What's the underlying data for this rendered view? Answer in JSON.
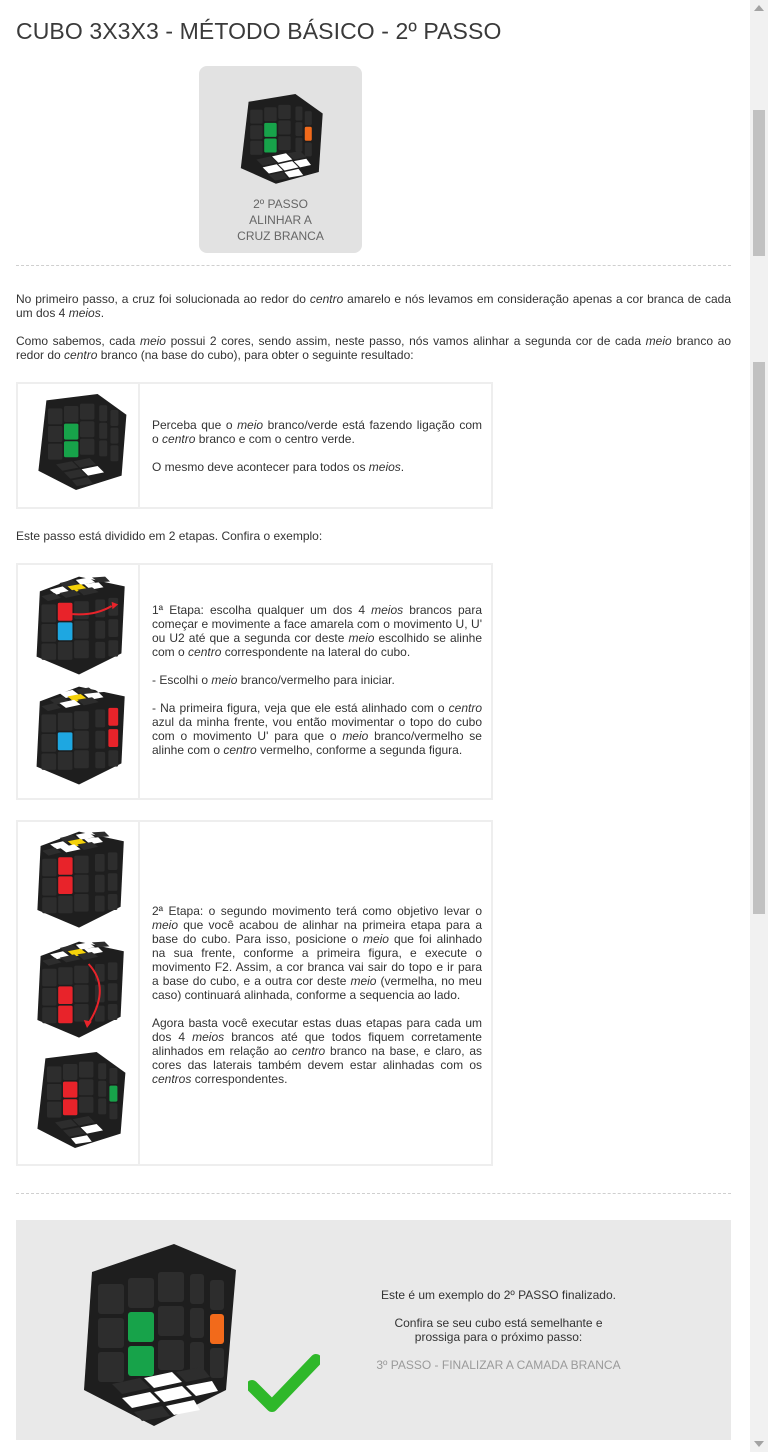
{
  "page": {
    "title": "CUBO 3X3X3 - MÉTODO BÁSICO - 2º PASSO"
  },
  "step_card": {
    "line1": "2º PASSO",
    "line2": "ALINHAR A",
    "line3": "CRUZ BRANCA"
  },
  "intro": {
    "p1": [
      {
        "t": "No primeiro passo, a cruz foi solucionada ao redor do "
      },
      {
        "t": "centro",
        "i": true
      },
      {
        "t": " amarelo e nós levamos em consideração apenas a cor branca de cada um dos 4 "
      },
      {
        "t": "meios",
        "i": true
      },
      {
        "t": "."
      }
    ],
    "p2": [
      {
        "t": "Como sabemos, cada "
      },
      {
        "t": "meio",
        "i": true
      },
      {
        "t": " possui 2 cores, sendo assim, neste passo, nós vamos alinhar a segunda cor de cada "
      },
      {
        "t": "meio",
        "i": true
      },
      {
        "t": " branco ao redor do "
      },
      {
        "t": "centro",
        "i": true
      },
      {
        "t": " branco (na base do cubo), para obter o seguinte resultado:"
      }
    ]
  },
  "box1": {
    "p1": [
      {
        "t": "Perceba que o "
      },
      {
        "t": "meio",
        "i": true
      },
      {
        "t": " branco/verde está fazendo ligação com o "
      },
      {
        "t": "centro",
        "i": true
      },
      {
        "t": " branco e com o centro verde."
      }
    ],
    "p2": [
      {
        "t": "O mesmo deve acontecer para todos os "
      },
      {
        "t": "meios",
        "i": true
      },
      {
        "t": "."
      }
    ]
  },
  "divided_text": "Este passo está dividido em 2 etapas. Confira o exemplo:",
  "box2": {
    "p1": [
      {
        "t": "1ª Etapa: escolha qualquer um dos 4 "
      },
      {
        "t": "meios",
        "i": true
      },
      {
        "t": " brancos para começar e movimente a face amarela com o movimento U, U' ou U2 até que a segunda cor deste "
      },
      {
        "t": "meio",
        "i": true
      },
      {
        "t": " escolhido se alinhe com o "
      },
      {
        "t": "centro",
        "i": true
      },
      {
        "t": " correspondente na lateral do cubo."
      }
    ],
    "p2": [
      {
        "t": "- Escolhi o "
      },
      {
        "t": "meio",
        "i": true
      },
      {
        "t": " branco/vermelho para iniciar."
      }
    ],
    "p3": [
      {
        "t": "- Na primeira figura, veja que ele está alinhado com o "
      },
      {
        "t": "centro",
        "i": true
      },
      {
        "t": " azul da minha frente, vou então movimentar o topo do cubo com o movimento U' para que o "
      },
      {
        "t": "meio",
        "i": true
      },
      {
        "t": " branco/vermelho se alinhe com o "
      },
      {
        "t": "centro",
        "i": true
      },
      {
        "t": " vermelho, conforme a segunda figura."
      }
    ]
  },
  "box3": {
    "p1": [
      {
        "t": "2ª Etapa: o segundo movimento terá como objetivo levar o "
      },
      {
        "t": "meio",
        "i": true
      },
      {
        "t": " que você acabou de alinhar na primeira etapa para a base do cubo. Para isso, posicione o "
      },
      {
        "t": "meio",
        "i": true
      },
      {
        "t": " que foi alinhado na sua frente, conforme a primeira figura, e execute o movimento F2. Assim, a cor branca vai sair do topo e ir para a base do cubo, e a outra cor deste "
      },
      {
        "t": "meio",
        "i": true
      },
      {
        "t": " (vermelha, no meu caso) continuará alinhada, conforme a sequencia ao lado."
      }
    ],
    "p2": [
      {
        "t": "Agora basta você executar estas duas etapas para cada um dos 4 "
      },
      {
        "t": "meios",
        "i": true
      },
      {
        "t": " brancos até que todos fiquem corretamente alinhados em relação ao "
      },
      {
        "t": "centro",
        "i": true
      },
      {
        "t": " branco na base, e claro, as cores das laterais também devem estar alinhadas com os "
      },
      {
        "t": "centros",
        "i": true
      },
      {
        "t": " correspondentes."
      }
    ]
  },
  "final": {
    "line1": "Este é um exemplo do 2º PASSO finalizado.",
    "line2": "Confira se seu cubo está semelhante e",
    "line3": "prossiga para o próximo passo:",
    "next_link": "3º PASSO - FINALIZAR A CAMADA BRANCA"
  },
  "colors": {
    "cube_body": "#1e1e1e",
    "sticker_dark": "#2d2d2d",
    "green": "#17a34a",
    "orange": "#f26a1b",
    "red": "#e8232a",
    "blue": "#1ea7e1",
    "yellow": "#f5d20a",
    "white": "#ffffff",
    "check_green": "#2fb82a"
  },
  "icons": {
    "check": "check-icon",
    "arrow_up": "scroll-up-arrow",
    "arrow_down": "scroll-down-arrow"
  }
}
